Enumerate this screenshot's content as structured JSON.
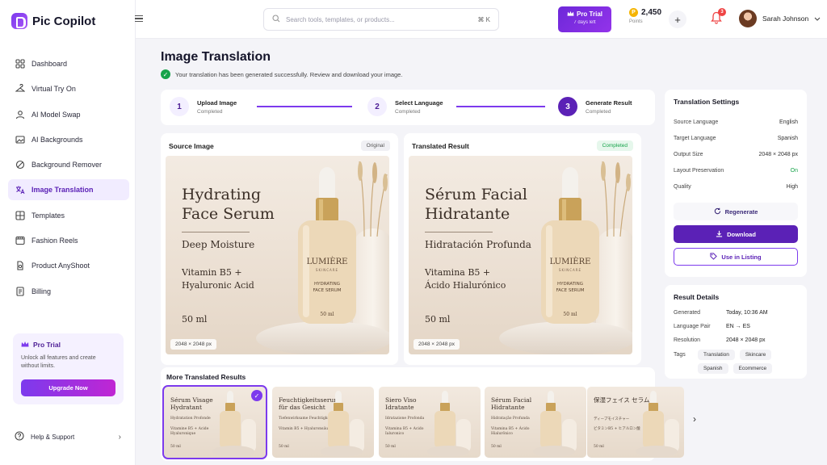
{
  "brand": {
    "name": "Pic Copilot"
  },
  "sidebar": {
    "items": [
      {
        "label": "Dashboard",
        "icon": "dashboard-icon"
      },
      {
        "label": "Virtual Try On",
        "icon": "hanger-icon"
      },
      {
        "label": "AI Model Swap",
        "icon": "person-icon"
      },
      {
        "label": "AI Backgrounds",
        "icon": "image-layers-icon"
      },
      {
        "label": "Background Remover",
        "icon": "eraser-icon"
      },
      {
        "label": "Image Translation",
        "icon": "translate-icon",
        "active": true
      },
      {
        "label": "Templates",
        "icon": "grid-icon"
      },
      {
        "label": "Fashion Reels",
        "icon": "film-icon"
      },
      {
        "label": "Product AnyShoot",
        "icon": "camera-icon"
      },
      {
        "label": "Billing",
        "icon": "receipt-icon"
      }
    ],
    "pro_card": {
      "title": "Pro Trial",
      "description": "Unlock all features and create without limits.",
      "button": "Upgrade Now"
    },
    "help": "Help & Support"
  },
  "topbar": {
    "search_placeholder": "Search tools, templates, or products...",
    "shortcut": "⌘ K",
    "trial": {
      "label": "Pro Trial",
      "sub": "7 days left"
    },
    "points": {
      "value": "2,450",
      "label": "Points"
    },
    "notifications": "3",
    "user_name": "Sarah Johnson"
  },
  "header": {
    "title": "Image Translation",
    "success_message": "Your translation has been generated successfully. Review and download your image."
  },
  "steps": [
    {
      "num": "1",
      "title": "Upload Image",
      "status": "Completed"
    },
    {
      "num": "2",
      "title": "Select Language",
      "status": "Completed"
    },
    {
      "num": "3",
      "title": "Generate Result",
      "status": "Completed"
    }
  ],
  "source": {
    "title": "Source Image",
    "tag": "Original",
    "product_title_1": "Hydrating",
    "product_title_2": "Face Serum",
    "subtitle": "Deep Moisture",
    "vit_1": "Vitamin B5 +",
    "vit_2": "Hyaluronic Acid",
    "volume": "50 ml",
    "size": "2048 × 2048 px",
    "label_brand": "LUMIÈRE",
    "label_sub": "SKINCARE",
    "label_l1": "HYDRATING",
    "label_l2": "FACE SERUM",
    "label_vol": "50 ml"
  },
  "result": {
    "title": "Translated Result",
    "tag": "Completed",
    "product_title_1": "Sérum Facial",
    "product_title_2": "Hidratante",
    "subtitle": "Hidratación Profunda",
    "vit_1": "Vitamina B5 +",
    "vit_2": "Ácido Hialurónico",
    "volume": "50 ml",
    "size": "2048 × 2048 px",
    "label_brand": "LUMIÈRE",
    "label_sub": "SKINCARE",
    "label_l1": "HYDRATING",
    "label_l2": "FACE SERUM",
    "label_vol": "50 ml"
  },
  "settings": {
    "title": "Translation Settings",
    "rows": [
      {
        "k": "Source Language",
        "v": "English"
      },
      {
        "k": "Target Language",
        "v": "Spanish"
      },
      {
        "k": "Output Size",
        "v": "2048 × 2048 px"
      },
      {
        "k": "Layout Preservation",
        "v": "On"
      },
      {
        "k": "Quality",
        "v": "High"
      }
    ],
    "regenerate": "Regenerate",
    "download": "Download",
    "listing": "Use in Listing"
  },
  "details": {
    "title": "Result Details",
    "rows": [
      {
        "k": "Generated",
        "v": "Today, 10:36 AM"
      },
      {
        "k": "Language Pair",
        "v": "EN → ES"
      },
      {
        "k": "Resolution",
        "v": "2048 × 2048 px"
      }
    ],
    "tags_label": "Tags",
    "tags": [
      "Translation",
      "Skincare",
      "Spanish",
      "Ecommerce"
    ]
  },
  "more": {
    "title": "More Translated Results",
    "items": [
      {
        "t": "Sérum Visage Hydratant",
        "s": "Hydratation Profonde",
        "v": "Vitamine B5 + Acide Hyaluronique",
        "m": "50 ml"
      },
      {
        "t": "Feuchtigkeitsserum für das Gesicht",
        "s": "Tiefenwirksame Feuchtigkeit",
        "v": "Vitamin B5 + Hyaluronsäure",
        "m": "50 ml"
      },
      {
        "t": "Siero Viso Idratante",
        "s": "Idratazione Profonda",
        "v": "Vitamina B5 + Acido Ialuronico",
        "m": "50 ml"
      },
      {
        "t": "Sérum Facial Hidratante",
        "s": "Hidratação Profunda",
        "v": "Vitamina B5 + Ácido Hialurônico",
        "m": "50 ml"
      },
      {
        "t": "保湿フェイス セラム",
        "s": "ディープモイスチャー",
        "v": "ビタミンB5 + ヒアルロン酸",
        "m": "50 ml"
      }
    ]
  },
  "colors": {
    "accent": "#5b21b6",
    "success": "#16a34a",
    "alert": "#ef4444"
  }
}
